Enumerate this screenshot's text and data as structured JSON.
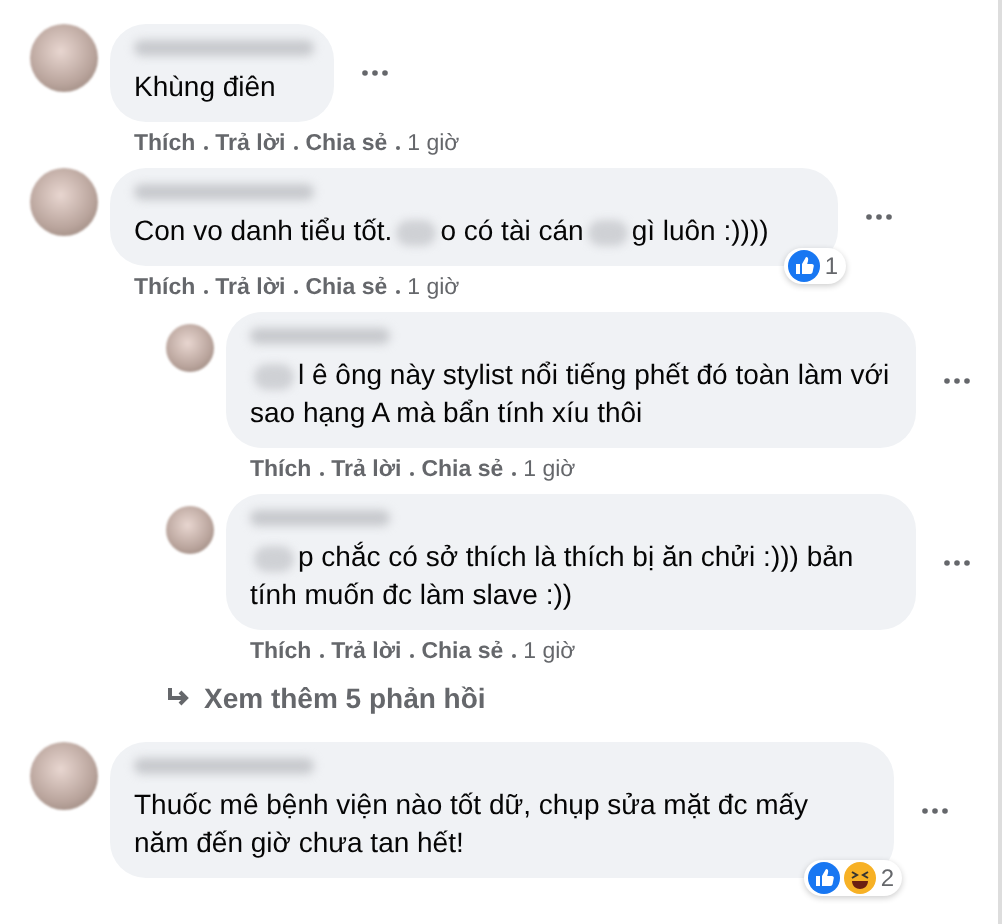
{
  "comments": [
    {
      "segments": [
        {
          "kind": "text",
          "text": "Khùng điên"
        }
      ],
      "actions": [
        "Thích",
        "Trả lời",
        "Chia sẻ"
      ],
      "time": "1 giờ"
    },
    {
      "segments": [
        {
          "kind": "text",
          "text": "Con vo danh tiểu tốt."
        },
        {
          "kind": "blur"
        },
        {
          "kind": "text",
          "text": "o có tài cán"
        },
        {
          "kind": "blur"
        },
        {
          "kind": "text",
          "text": "gì luôn :))))"
        }
      ],
      "actions": [
        "Thích",
        "Trả lời",
        "Chia sẻ"
      ],
      "time": "1 giờ",
      "reactions": [
        {
          "kind": "like"
        }
      ],
      "count": "1",
      "replies": [
        {
          "segments": [
            {
              "kind": "blur"
            },
            {
              "kind": "text",
              "text": "l ê ông này stylist nổi tiếng phết đó toàn làm với sao hạng A mà bẩn tính xíu thôi"
            }
          ],
          "actions": [
            "Thích",
            "Trả lời",
            "Chia sẻ"
          ],
          "time": "1 giờ"
        },
        {
          "segments": [
            {
              "kind": "blur"
            },
            {
              "kind": "text",
              "text": "p chắc có sở thích là thích bị ăn chửi :))) bản tính muốn đc làm slave :))"
            }
          ],
          "actions": [
            "Thích",
            "Trả lời",
            "Chia sẻ"
          ],
          "time": "1 giờ"
        }
      ],
      "more": "Xem thêm 5 phản hồi"
    },
    {
      "segments": [
        {
          "kind": "text",
          "text": "Thuốc mê bệnh viện nào tốt dữ, chụp sửa mặt đc mấy năm đến giờ chưa tan hết!"
        }
      ],
      "reactions": [
        {
          "kind": "like"
        },
        {
          "kind": "haha"
        }
      ],
      "count": "2"
    }
  ]
}
